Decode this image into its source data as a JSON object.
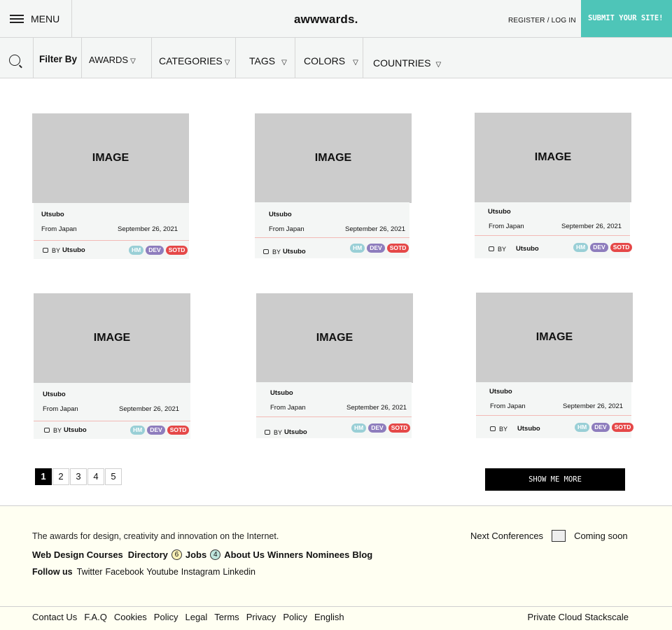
{
  "header": {
    "menu_label": "MENU",
    "logo": "awwwards.",
    "register": "REGISTER / LOG IN",
    "submit": "SUBMIT YOUR SITE!"
  },
  "filters": {
    "label": "Filter By",
    "items": [
      "AWARDS",
      "CATEGORIES",
      "TAGS",
      "COLORS",
      "COUNTRIES"
    ],
    "caret": "▽"
  },
  "cards": [
    {
      "image": "IMAGE",
      "title": "Utsubo",
      "from": "From Japan",
      "date": "September 26, 2021",
      "by": "BY",
      "author": "Utsubo",
      "badges": [
        "HM",
        "DEV",
        "SOTD"
      ]
    },
    {
      "image": "IMAGE",
      "title": "Utsubo",
      "from": "From Japan",
      "date": "September 26, 2021",
      "by": "BY",
      "author": "Utsubo",
      "badges": [
        "HM",
        "DEV",
        "SOTD"
      ]
    },
    {
      "image": "IMAGE",
      "title": "Utsubo",
      "from": "From Japan",
      "date": "September 26, 2021",
      "by": "BY",
      "author": "Utsubo",
      "badges": [
        "HM",
        "DEV",
        "SOTD"
      ]
    },
    {
      "image": "IMAGE",
      "title": "Utsubo",
      "from": "From Japan",
      "date": "September 26, 2021",
      "by": "BY",
      "author": "Utsubo",
      "badges": [
        "HM",
        "DEV",
        "SOTD"
      ]
    },
    {
      "image": "IMAGE",
      "title": "Utsubo",
      "from": "From Japan",
      "date": "September 26, 2021",
      "by": "BY",
      "author": "Utsubo",
      "badges": [
        "HM",
        "DEV",
        "SOTD"
      ]
    },
    {
      "image": "IMAGE",
      "title": "Utsubo",
      "from": "From Japan",
      "date": "September 26, 2021",
      "by": "BY",
      "author": "Utsubo",
      "badges": [
        "HM",
        "DEV",
        "SOTD"
      ]
    }
  ],
  "pagination": {
    "pages": [
      "1",
      "2",
      "3",
      "4",
      "5"
    ],
    "current": "1"
  },
  "show_more": "SHOW ME MORE",
  "footer": {
    "tagline": "The awards for design, creativity and innovation on the Internet.",
    "links": {
      "web_design_courses": "Web Design Courses",
      "directory": "Directory",
      "directory_count": "6",
      "jobs": "Jobs",
      "jobs_count": "4",
      "about": "About Us",
      "winners": "Winners",
      "nominees": "Nominees",
      "blog": "Blog"
    },
    "follow_label": "Follow us",
    "socials": [
      "Twitter",
      "Facebook",
      "Youtube",
      "Instagram",
      "Linkedin"
    ],
    "conferences_label": "Next Conferences",
    "coming_soon": "Coming soon",
    "bottom_links": [
      "Contact Us",
      "F.A.Q",
      "Cookies",
      "Policy",
      "Legal",
      "Terms",
      "Privacy",
      "Policy",
      "English"
    ],
    "private": "Private Cloud Stackscale"
  },
  "colors": {
    "accent": "#4ec5b8",
    "hm": "#99cfd6",
    "dev": "#8e7dbd",
    "sotd": "#e54848",
    "footer_bg": "#fffff2"
  }
}
